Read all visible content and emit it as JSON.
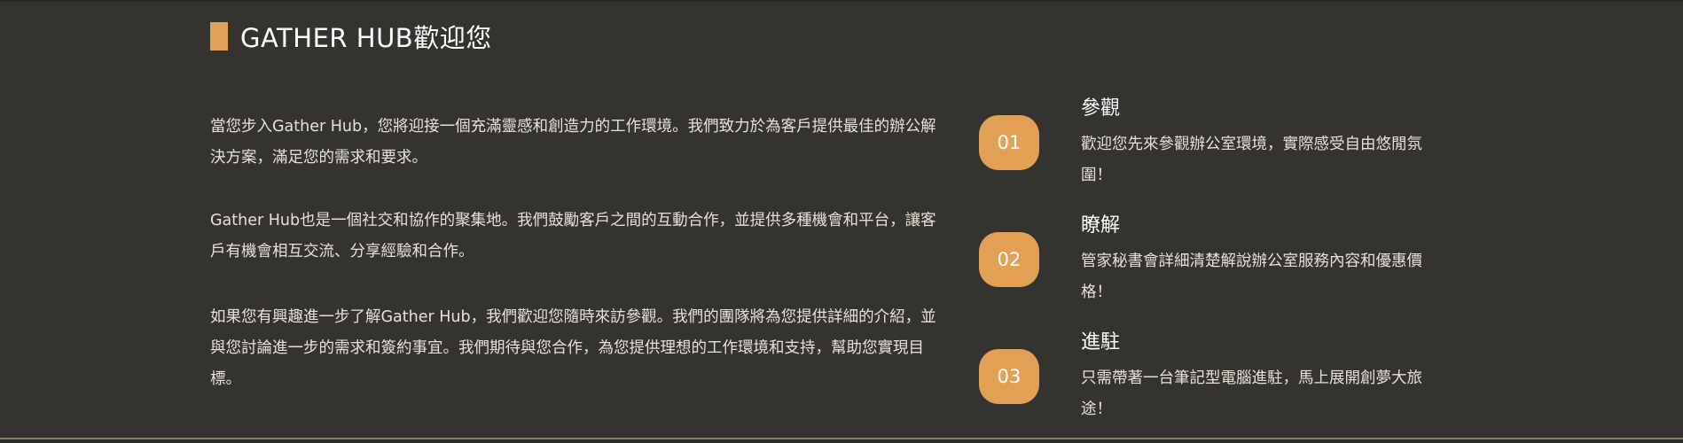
{
  "heading": {
    "title": "GATHER HUB歡迎您"
  },
  "intro": {
    "paragraphs": [
      "當您步入Gather Hub，您將迎接一個充滿靈感和創造力的工作環境。我們致力於為客戶提供最佳的辦公解決方案，滿足您的需求和要求。",
      "Gather Hub也是一個社交和協作的聚集地。我們鼓勵客戶之間的互動合作，並提供多種機會和平台，讓客戶有機會相互交流、分享經驗和合作。",
      "如果您有興趣進一步了解Gather Hub，我們歡迎您隨時來訪參觀。我們的團隊將為您提供詳細的介紹，並與您討論進一步的需求和簽約事宜。我們期待與您合作，為您提供理想的工作環境和支持，幫助您實現目標。"
    ]
  },
  "steps": [
    {
      "number": "01",
      "title": "參觀",
      "description": "歡迎您先來參觀辦公室環境，實際感受自由悠閒氛圍！"
    },
    {
      "number": "02",
      "title": "瞭解",
      "description": "管家秘書會詳細清楚解說辦公室服務內容和優惠價格！"
    },
    {
      "number": "03",
      "title": "進駐",
      "description": "只需帶著一台筆記型電腦進駐，馬上展開創夢大旅途！"
    }
  ],
  "colors": {
    "background": "#353330",
    "accent": "#e2a054",
    "text": "#e6e1d8"
  }
}
